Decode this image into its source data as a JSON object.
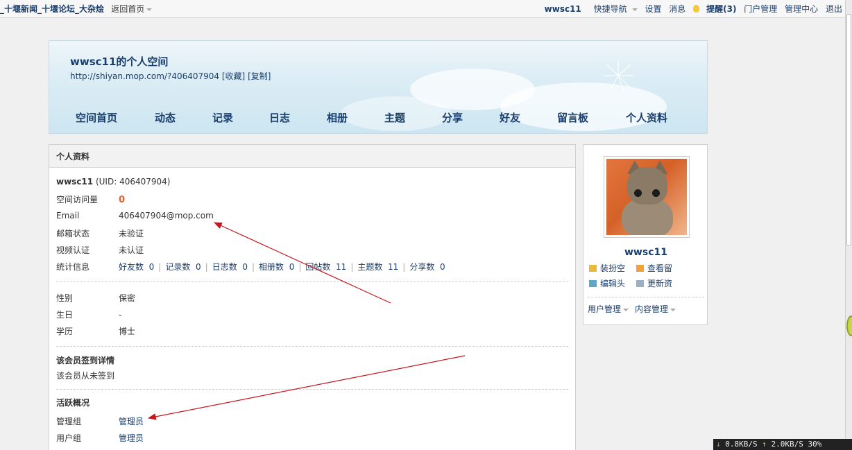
{
  "topbar": {
    "site_links": "_十堰新闻_十堰论坛_大杂烩",
    "home": "返回首页",
    "username": "wwsc11",
    "quick_nav": "快捷导航",
    "settings": "设置",
    "messages": "消息",
    "reminders": "提醒(3)",
    "portal_admin": "门户管理",
    "admin_center": "管理中心",
    "logout": "退出"
  },
  "banner": {
    "title": "wwsc11的个人空间",
    "url": "http://shiyan.mop.com/?406407904",
    "favorite": "[收藏]",
    "copy": "[复制]",
    "nav": [
      "空间首页",
      "动态",
      "记录",
      "日志",
      "相册",
      "主题",
      "分享",
      "好友",
      "留言板",
      "个人资料"
    ]
  },
  "profile": {
    "header": "个人资料",
    "username": "wwsc11",
    "uid": "(UID: 406407904)",
    "visits_label": "空间访问量",
    "visits": "0",
    "email_label": "Email",
    "email": "406407904@mop.com",
    "mail_status_label": "邮箱状态",
    "mail_status": "未验证",
    "video_label": "视频认证",
    "video": "未认证",
    "stats_label": "统计信息",
    "stats": [
      {
        "label": "好友数",
        "value": "0"
      },
      {
        "label": "记录数",
        "value": "0"
      },
      {
        "label": "日志数",
        "value": "0"
      },
      {
        "label": "相册数",
        "value": "0"
      },
      {
        "label": "回帖数",
        "value": "11"
      },
      {
        "label": "主题数",
        "value": "11"
      },
      {
        "label": "分享数",
        "value": "0"
      }
    ],
    "gender_label": "性别",
    "gender": "保密",
    "birthday_label": "生日",
    "birthday": "-",
    "education_label": "学历",
    "education": "博士",
    "signin_title": "该会员签到详情",
    "signin_text": "该会员从未签到",
    "activity_title": "活跃概况",
    "admin_group_label": "管理组",
    "admin_group": "管理员",
    "user_group_label": "用户组",
    "user_group": "管理员"
  },
  "sidebar": {
    "username": "wwsc11",
    "actions": [
      "装扮空",
      "查看留",
      "编辑头",
      "更新资"
    ],
    "user_mgmt": "用户管理",
    "content_mgmt": "内容管理"
  },
  "speed": {
    "down": "0.8KB/S",
    "up": "2.0KB/S",
    "pct": "30%"
  }
}
